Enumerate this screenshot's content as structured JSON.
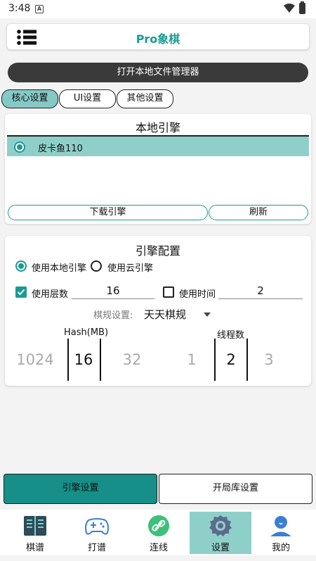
{
  "status": {
    "time": "3:48",
    "notif_icon": "A"
  },
  "header": {
    "title": "Pro象棋",
    "menu_icon": "hamburger-menu-icon"
  },
  "open_button": "打开本地文件管理器",
  "tabs": [
    {
      "label": "核心设置",
      "active": true
    },
    {
      "label": "UI设置",
      "active": false
    },
    {
      "label": "其他设置",
      "active": false
    }
  ],
  "local_engine": {
    "title": "本地引擎",
    "engines": [
      {
        "name": "皮卡鱼110",
        "selected": true
      }
    ],
    "download_label": "下载引擎",
    "refresh_label": "刷新"
  },
  "engine_config": {
    "title": "引擎配置",
    "use_local_label": "使用本地引擎",
    "use_cloud_label": "使用云引擎",
    "engine_source": "local",
    "use_depth_label": "使用层数",
    "use_depth_checked": true,
    "depth_value": "16",
    "use_time_label": "使用时间",
    "use_time_checked": false,
    "time_value": "2",
    "rule_label": "棋规设置:",
    "rule_value": "天天棋规",
    "hash_label": "Hash(MB)",
    "hash_options": [
      "1024",
      "16",
      "32"
    ],
    "hash_selected": "16",
    "threads_label": "线程数",
    "thread_options": [
      "1",
      "2",
      "3"
    ],
    "thread_selected": "2"
  },
  "bottom_tabs": [
    {
      "label": "引擎设置",
      "active": true
    },
    {
      "label": "开局库设置",
      "active": false
    }
  ],
  "nav": [
    {
      "label": "棋谱",
      "icon": "book-icon",
      "active": false
    },
    {
      "label": "打谱",
      "icon": "gamepad-icon",
      "active": false
    },
    {
      "label": "连线",
      "icon": "link-icon",
      "active": false
    },
    {
      "label": "设置",
      "icon": "gear-icon",
      "active": true
    },
    {
      "label": "我的",
      "icon": "user-icon",
      "active": false
    }
  ],
  "colors": {
    "accent": "#179b94",
    "highlight": "#8fcfca",
    "dark_button": "#3a3a3a"
  }
}
